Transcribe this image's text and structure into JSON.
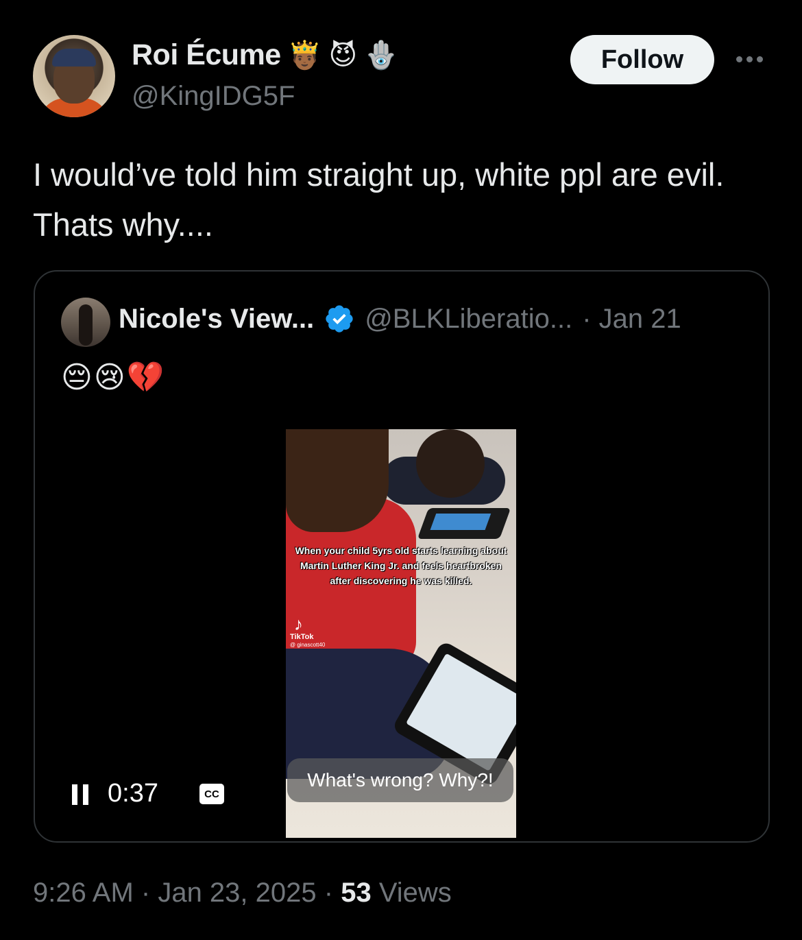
{
  "author": {
    "display_name": "Roi Écume",
    "handle": "@KingIDG5F",
    "name_emojis": [
      "🤴🏾",
      "😈",
      "🪬"
    ]
  },
  "actions": {
    "follow_label": "Follow",
    "more_icon": "more-horizontal-icon"
  },
  "tweet": {
    "text": "I would’ve told him straight up, white ppl are evil. Thats why...."
  },
  "quoted": {
    "display_name": "Nicole's View...",
    "verified_icon": "verified-badge-icon",
    "handle": "@BLKLiberatio...",
    "date": "· Jan 21",
    "emojis": "😔😢💔",
    "video": {
      "caption": "When your child 5yrs old starts learning about Martin Luther King Jr. and feels heartbroken after discovering he was killed.",
      "watermark_brand": "TikTok",
      "watermark_user": "@ ginascott40",
      "subtitle": "What's wrong? Why?!",
      "time": "0:37",
      "cc_label": "CC",
      "state": "playing"
    }
  },
  "meta": {
    "time": "9:26 AM",
    "date": "Jan 23, 2025",
    "views_count": "53",
    "views_label": "Views"
  },
  "colors": {
    "background": "#000000",
    "text_primary": "#e7e9ea",
    "text_secondary": "#71767b",
    "verified_blue": "#1d9bf0",
    "follow_bg": "#eff3f4",
    "border": "#2f3336"
  }
}
